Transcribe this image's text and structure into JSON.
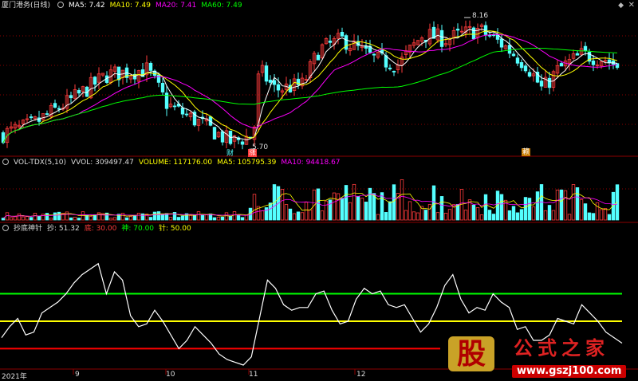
{
  "colors": {
    "bg": "#000000",
    "up": "#ff3b3b",
    "down": "#54ffff",
    "ma5": "#ffffff",
    "ma10": "#ffff00",
    "ma20": "#ff00ff",
    "ma60": "#00ff00",
    "grid": "#8b0000"
  },
  "price_panel": {
    "title": "厦门港务(日线)",
    "ma5": "MA5: 7.42",
    "ma10": "MA10: 7.49",
    "ma20": "MA20: 7.41",
    "ma60": "MA60: 7.49",
    "high_label": "8.16",
    "low_label": "5.70",
    "marker_cai": "财",
    "marker_zhang": "涨",
    "marker_fu": "赖"
  },
  "volume_panel": {
    "title": "VOL-TDX(5,10)",
    "vvol": "VVOL: 309497.47",
    "volume": "VOLUME: 117176.00",
    "ma5": "MA5: 105795.39",
    "ma10": "MA10: 94418.67"
  },
  "indicator_panel": {
    "title": "抄底神针",
    "chao": "抄: 51.32",
    "di": "底: 30.00",
    "shen": "神: 70.00",
    "zhen": "针: 50.00"
  },
  "x_axis": {
    "labels": [
      "2021年",
      "9",
      "10",
      "11",
      "12"
    ]
  },
  "watermark": {
    "logo_char": "股",
    "name": "公式之家",
    "url": "www.gszj100.com"
  },
  "chart_data": [
    {
      "type": "candlestick",
      "title": "厦门港务(日线)",
      "series": [
        {
          "name": "MA5",
          "values": [
            7.42
          ]
        },
        {
          "name": "MA10",
          "values": [
            7.49
          ]
        },
        {
          "name": "MA20",
          "values": [
            7.41
          ]
        },
        {
          "name": "MA60",
          "values": [
            7.49
          ]
        }
      ],
      "annotations": [
        "8.16",
        "5.70"
      ]
    },
    {
      "type": "bar",
      "title": "VOL-TDX(5,10)",
      "series": [
        {
          "name": "VVOL",
          "values": [
            309497.47
          ]
        },
        {
          "name": "VOLUME",
          "values": [
            117176.0
          ]
        },
        {
          "name": "MA5",
          "values": [
            105795.39
          ]
        },
        {
          "name": "MA10",
          "values": [
            94418.67
          ]
        }
      ]
    },
    {
      "type": "line",
      "title": "抄底神针",
      "series": [
        {
          "name": "抄",
          "values": [
            38,
            46,
            52,
            40,
            42,
            56,
            60,
            64,
            70,
            78,
            84,
            88,
            92,
            70,
            86,
            80,
            54,
            46,
            48,
            58,
            50,
            40,
            30,
            36,
            46,
            40,
            34,
            26,
            22,
            20,
            18,
            24,
            52,
            80,
            74,
            62,
            58,
            60,
            60,
            70,
            72,
            58,
            48,
            50,
            66,
            74,
            70,
            72,
            62,
            60,
            62,
            52,
            42,
            48,
            60,
            76,
            84,
            66,
            56,
            60,
            58,
            70,
            64,
            60,
            44,
            46,
            36,
            36,
            40,
            52,
            50,
            48,
            62,
            56,
            50,
            42,
            38,
            34
          ],
          "note": ""
        },
        {
          "name": "底",
          "values": [
            30
          ]
        },
        {
          "name": "神",
          "values": [
            70
          ]
        },
        {
          "name": "针",
          "values": [
            50
          ]
        }
      ]
    }
  ]
}
